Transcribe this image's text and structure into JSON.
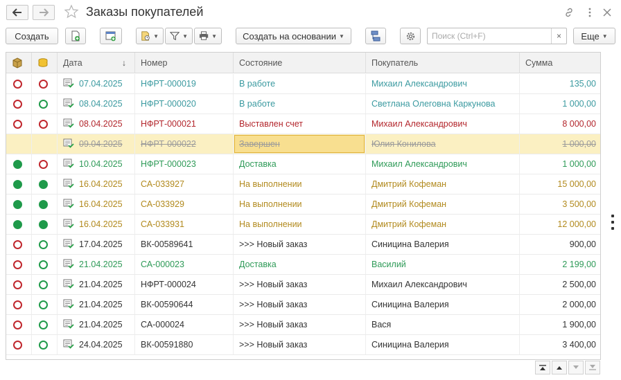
{
  "window": {
    "title": "Заказы покупателей"
  },
  "toolbar": {
    "create_label": "Создать",
    "create_based_on_label": "Создать на основании",
    "search_placeholder": "Поиск (Ctrl+F)",
    "search_clear": "×",
    "more_label": "Еще"
  },
  "table": {
    "columns": [
      "Дата",
      "Номер",
      "Состояние",
      "Покупатель",
      "Сумма"
    ],
    "sort_indicator": "↓",
    "rows": [
      {
        "status1": "red-outline",
        "status2": "red-outline",
        "date": "07.04.2025",
        "number": "НФРТ-000019",
        "state": "В работе",
        "customer": "Михаил Александрович",
        "amount": "135,00",
        "color": "#3b9aa0",
        "strike": false
      },
      {
        "status1": "red-outline",
        "status2": "green-outline",
        "date": "08.04.2025",
        "number": "НФРТ-000020",
        "state": "В работе",
        "customer": "Светлана Олеговна Каркунова",
        "amount": "1 000,00",
        "color": "#3b9aa0",
        "strike": false
      },
      {
        "status1": "red-outline",
        "status2": "red-outline",
        "date": "08.04.2025",
        "number": "НФРТ-000021",
        "state": "Выставлен счет",
        "customer": "Михаил Александрович",
        "amount": "8 000,00",
        "color": "#b3262c",
        "strike": false
      },
      {
        "status1": "none",
        "status2": "none",
        "date": "09.04.2025",
        "number": "НФРТ-000022",
        "state": "Завершен",
        "customer": "Юлия Конилова",
        "amount": "1 000,00",
        "color": "#9b9b9b",
        "strike": true
      },
      {
        "status1": "green-fill",
        "status2": "red-outline",
        "date": "10.04.2025",
        "number": "НФРТ-000023",
        "state": "Доставка",
        "customer": "Михаил Александрович",
        "amount": "1 000,00",
        "color": "#2e9a57",
        "strike": false
      },
      {
        "status1": "green-fill",
        "status2": "green-fill",
        "date": "16.04.2025",
        "number": "СА-033927",
        "state": "На выполнении",
        "customer": "Дмитрий Кофеман",
        "amount": "15 000,00",
        "color": "#b28a1e",
        "strike": false
      },
      {
        "status1": "green-fill",
        "status2": "green-fill",
        "date": "16.04.2025",
        "number": "СА-033929",
        "state": "На выполнении",
        "customer": "Дмитрий Кофеман",
        "amount": "3 500,00",
        "color": "#b28a1e",
        "strike": false
      },
      {
        "status1": "green-fill",
        "status2": "green-fill",
        "date": "16.04.2025",
        "number": "СА-033931",
        "state": "На выполнении",
        "customer": "Дмитрий Кофеман",
        "amount": "12 000,00",
        "color": "#b28a1e",
        "strike": false
      },
      {
        "status1": "red-outline",
        "status2": "green-outline",
        "date": "17.04.2025",
        "number": "ВК-00589641",
        "state": ">>>  Новый заказ",
        "customer": "Синицина Валерия",
        "amount": "900,00",
        "color": "#333333",
        "strike": false
      },
      {
        "status1": "red-outline",
        "status2": "green-outline",
        "date": "21.04.2025",
        "number": "СА-000023",
        "state": "Доставка",
        "customer": "Василий",
        "amount": "2 199,00",
        "color": "#2e9a57",
        "strike": false
      },
      {
        "status1": "red-outline",
        "status2": "green-outline",
        "date": "21.04.2025",
        "number": "НФРТ-000024",
        "state": ">>>  Новый заказ",
        "customer": "Михаил Александрович",
        "amount": "2 500,00",
        "color": "#333333",
        "strike": false
      },
      {
        "status1": "red-outline",
        "status2": "green-outline",
        "date": "21.04.2025",
        "number": "ВК-00590644",
        "state": ">>>  Новый заказ",
        "customer": "Синицина Валерия",
        "amount": "2 000,00",
        "color": "#333333",
        "strike": false
      },
      {
        "status1": "red-outline",
        "status2": "green-outline",
        "date": "21.04.2025",
        "number": "СА-000024",
        "state": ">>>  Новый заказ",
        "customer": "Вася",
        "amount": "1 900,00",
        "color": "#333333",
        "strike": false
      },
      {
        "status1": "red-outline",
        "status2": "green-outline",
        "date": "24.04.2025",
        "number": "ВК-00591880",
        "state": ">>>  Новый заказ",
        "customer": "Синицина Валерия",
        "amount": "3 400,00",
        "color": "#333333",
        "strike": false
      }
    ],
    "selected_row": 3
  },
  "colors": {
    "red": "#c0262d",
    "green": "#1f9a4a",
    "selected_bg": "#fbf0c2"
  }
}
